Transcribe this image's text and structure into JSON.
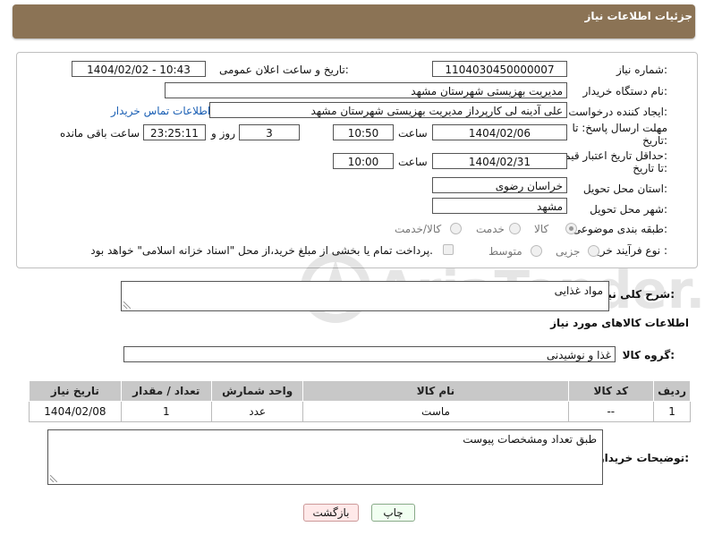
{
  "header": {
    "title": "جزئیات اطلاعات نیاز"
  },
  "fields": {
    "need_number_label": "شماره نیاز:",
    "need_number": "1104030450000007",
    "announce_label": "تاریخ و ساعت اعلان عمومی:",
    "announce_value": "1404/02/02 - 10:43",
    "buyer_org_label": "نام دستگاه خریدار:",
    "buyer_org": "مدیریت بهزیستی شهرستان مشهد",
    "creator_label": "ایجاد کننده درخواست:",
    "creator": "علی آدینه لی کارپرداز مدیریت بهزیستی شهرستان مشهد",
    "buyer_contact_link": "اطلاعات تماس خریدار",
    "reply_deadline_label_1": "مهلت ارسال پاسخ: تا",
    "reply_deadline_label_2": "تاریخ:",
    "reply_date": "1404/02/06",
    "time_label": "ساعت",
    "reply_time": "10:50",
    "days_value": "3",
    "days_label": "روز و",
    "remaining_time": "23:25:11",
    "remaining_label": "ساعت باقی مانده",
    "price_validity_label_1": "حداقل تاریخ اعتبار قیمت:",
    "price_validity_label_2": "تا تاریخ:",
    "price_date": "1404/02/31",
    "price_time": "10:00",
    "province_label": "استان محل تحویل:",
    "province": "خراسان رضوی",
    "city_label": "شهر محل تحویل:",
    "city": "مشهد",
    "category_label": "طبقه بندی موضوعی:",
    "category_options": [
      "کالا",
      "خدمت",
      "کالا/خدمت"
    ],
    "process_label": "نوع فرآیند خرید :",
    "process_options": [
      "جزیی",
      "متوسط"
    ],
    "payment_note": "پرداخت تمام یا بخشی از مبلغ خرید،از محل \"اسناد خزانه اسلامی\" خواهد بود."
  },
  "summary": {
    "label": "شرح کلی نیاز:",
    "value": "مواد غذایی"
  },
  "goods_info": {
    "title": "اطلاعات کالاهای مورد نیاز",
    "group_label": "گروه کالا:",
    "group_value": "غذا و نوشیدنی"
  },
  "table": {
    "headers": [
      "ردیف",
      "کد کالا",
      "نام کالا",
      "واحد شمارش",
      "تعداد / مقدار",
      "تاریخ نیاز"
    ],
    "rows": [
      [
        "1",
        "--",
        "ماست",
        "عدد",
        "1",
        "1404/02/08"
      ]
    ]
  },
  "buyer_notes": {
    "label": "توضیحات خریدار:",
    "value": "طبق تعداد ومشخصات پیوست"
  },
  "buttons": {
    "print": "چاپ",
    "back": "بازگشت"
  },
  "watermark_text": "AriaTender.net"
}
